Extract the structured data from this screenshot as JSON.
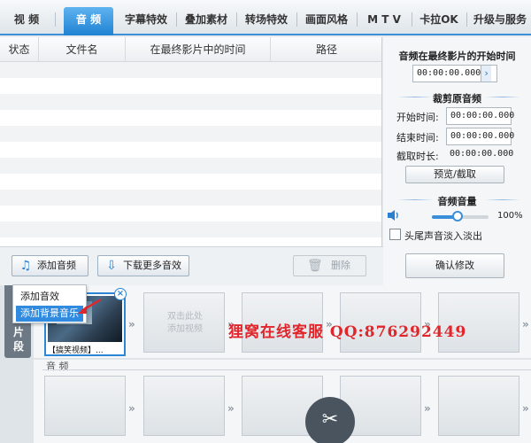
{
  "tabs": [
    "视 频",
    "音 频",
    "字幕特效",
    "叠加素材",
    "转场特效",
    "画面风格",
    "M T V",
    "卡拉OK",
    "升级与服务"
  ],
  "active_tab": 1,
  "table": {
    "columns": [
      "状态",
      "文件名",
      "在最终影片中的时间",
      "路径"
    ],
    "rows": []
  },
  "right_panel": {
    "start_time_title": "音频在最终影片的开始时间",
    "start_time_value": "00:00:00.000",
    "trim_title": "裁剪原音频",
    "start_label": "开始时间:",
    "start_value": "00:00:00.000",
    "end_label": "结束时间:",
    "end_value": "00:00:00.000",
    "duration_label": "截取时长:",
    "duration_value": "00:00:00.000",
    "preview_button": "预览/截取",
    "volume_title": "音频音量",
    "volume_percent": "100%",
    "volume_level": 0.45,
    "fade_label": "头尾声音淡入淡出",
    "confirm_button": "确认修改"
  },
  "actions": {
    "add_audio": "添加音频",
    "download_more": "下载更多音效",
    "delete": "删除"
  },
  "popup": {
    "items": [
      "添加音效",
      "添加背景音乐"
    ],
    "selected": 1
  },
  "timeline": {
    "side_tab": [
      "片",
      "段"
    ],
    "clip_caption": "【搞笑视频】...",
    "placeholder": "双击此处\n添加视频",
    "audio_label": "音 频"
  },
  "watermark": "狸窝在线客服 QQ:876292449",
  "icons": {
    "add_audio": "music-note-plus-icon",
    "download": "download-arrow-icon",
    "delete": "trash-icon",
    "volume": "speaker-icon",
    "scissors": "scissors-icon"
  },
  "colors": {
    "accent": "#1f82d2",
    "watermark": "#e0262b"
  }
}
